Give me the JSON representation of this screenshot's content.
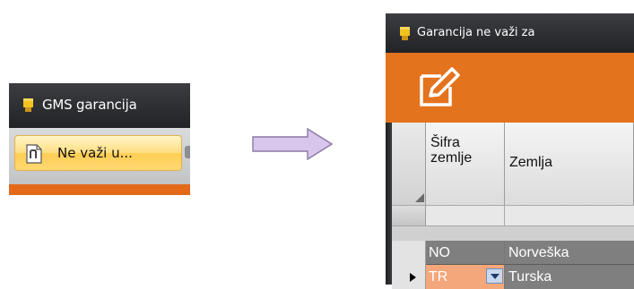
{
  "left_window": {
    "title": "GMS garancija",
    "tab_label": "Ne važi u..."
  },
  "right_window": {
    "title": "Garancija ne važi za",
    "columns": [
      "Šifra zemlje",
      "Zemlja"
    ],
    "rows": [
      {
        "code": "NO",
        "country": "Norveška"
      },
      {
        "code": "TR",
        "country": "Turska"
      }
    ]
  },
  "icons": {
    "app": "app-icon",
    "tab": "document-icon",
    "edit": "edit-pencil-icon",
    "arrow": "right-arrow-icon",
    "dropdown": "dropdown-arrow-icon",
    "row_pointer": "current-row-icon"
  },
  "colors": {
    "title_bar": "#2f3033",
    "accent_orange": "#e4731e",
    "tab_yellow": "#ffd874",
    "selected_row": "#7f7f7f",
    "edit_cell": "#f4a77a",
    "arrow_fill": "#d9c6ec"
  }
}
